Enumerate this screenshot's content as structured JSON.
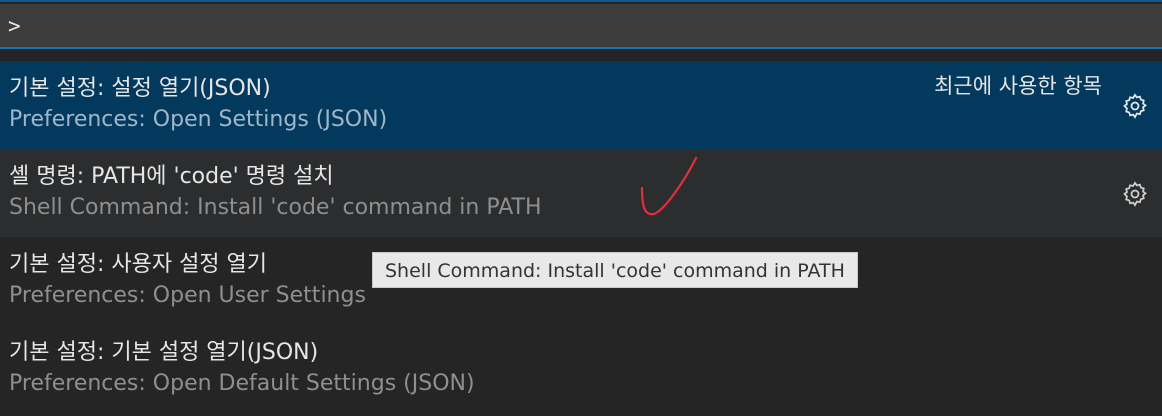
{
  "command_palette": {
    "input_value": ">",
    "items": [
      {
        "label": "기본 설정: 설정 열기(JSON)",
        "detail": "Preferences: Open Settings (JSON)",
        "badge": "최근에 사용한 항목",
        "gear_icon": "gear-icon",
        "selected": true
      },
      {
        "label": "셸 명령: PATH에 'code' 명령 설치",
        "detail": "Shell Command: Install 'code' command in PATH",
        "gear_icon": "gear-icon"
      },
      {
        "label": "기본 설정: 사용자 설정 열기",
        "detail": "Preferences: Open User Settings"
      },
      {
        "label": "기본 설정: 기본 설정 열기(JSON)",
        "detail": "Preferences: Open Default Settings (JSON)"
      }
    ],
    "tooltip": "Shell Command: Install 'code' command in PATH"
  },
  "colors": {
    "selected_bg": "#04395e",
    "hover_bg": "#2c2d2e",
    "panel_bg": "#252526",
    "focus_border": "#1e6fb3",
    "annotation_red": "#e0303a"
  }
}
